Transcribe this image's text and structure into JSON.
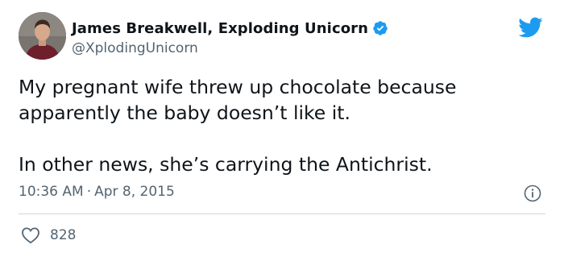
{
  "author": {
    "display_name": "James Breakwell, Exploding Unicorn",
    "handle": "@XplodingUnicorn",
    "verified": true,
    "avatar_icon": "profile-photo"
  },
  "tweet": {
    "lines": [
      "My pregnant wife threw up chocolate because",
      "apparently the baby doesn’t like it.",
      "In other news, she’s carrying the Antichrist."
    ]
  },
  "meta": {
    "time": "10:36 AM",
    "separator": "·",
    "date": "Apr 8, 2015"
  },
  "engagement": {
    "likes": "828"
  },
  "icons": {
    "brand": "twitter-bird-icon",
    "verified": "verified-badge-icon",
    "info": "info-icon",
    "like": "heart-icon"
  },
  "colors": {
    "brand_blue": "#1d9bf0",
    "text_primary": "#0f1419",
    "text_secondary": "#536471",
    "divider": "#cfd9de"
  }
}
